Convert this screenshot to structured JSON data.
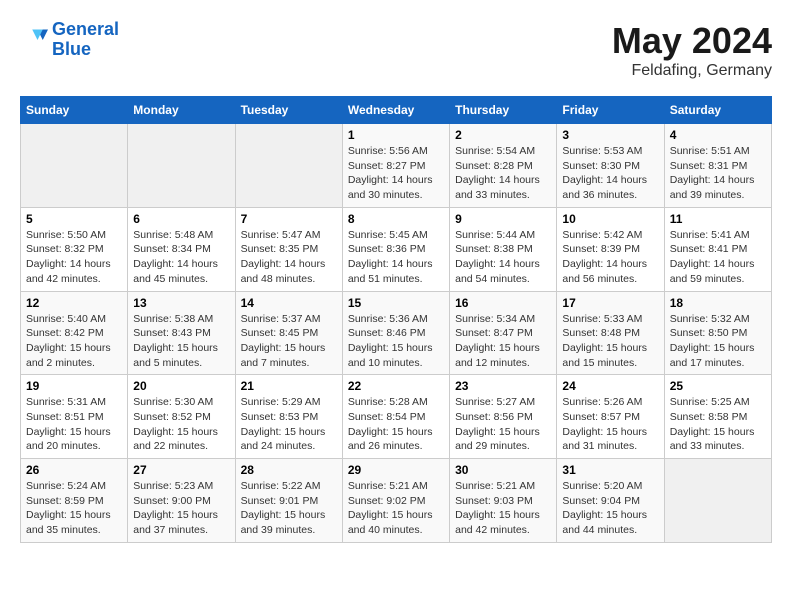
{
  "header": {
    "logo_line1": "General",
    "logo_line2": "Blue",
    "month": "May 2024",
    "location": "Feldafing, Germany"
  },
  "days_of_week": [
    "Sunday",
    "Monday",
    "Tuesday",
    "Wednesday",
    "Thursday",
    "Friday",
    "Saturday"
  ],
  "weeks": [
    [
      {
        "num": "",
        "info": ""
      },
      {
        "num": "",
        "info": ""
      },
      {
        "num": "",
        "info": ""
      },
      {
        "num": "1",
        "info": "Sunrise: 5:56 AM\nSunset: 8:27 PM\nDaylight: 14 hours\nand 30 minutes."
      },
      {
        "num": "2",
        "info": "Sunrise: 5:54 AM\nSunset: 8:28 PM\nDaylight: 14 hours\nand 33 minutes."
      },
      {
        "num": "3",
        "info": "Sunrise: 5:53 AM\nSunset: 8:30 PM\nDaylight: 14 hours\nand 36 minutes."
      },
      {
        "num": "4",
        "info": "Sunrise: 5:51 AM\nSunset: 8:31 PM\nDaylight: 14 hours\nand 39 minutes."
      }
    ],
    [
      {
        "num": "5",
        "info": "Sunrise: 5:50 AM\nSunset: 8:32 PM\nDaylight: 14 hours\nand 42 minutes."
      },
      {
        "num": "6",
        "info": "Sunrise: 5:48 AM\nSunset: 8:34 PM\nDaylight: 14 hours\nand 45 minutes."
      },
      {
        "num": "7",
        "info": "Sunrise: 5:47 AM\nSunset: 8:35 PM\nDaylight: 14 hours\nand 48 minutes."
      },
      {
        "num": "8",
        "info": "Sunrise: 5:45 AM\nSunset: 8:36 PM\nDaylight: 14 hours\nand 51 minutes."
      },
      {
        "num": "9",
        "info": "Sunrise: 5:44 AM\nSunset: 8:38 PM\nDaylight: 14 hours\nand 54 minutes."
      },
      {
        "num": "10",
        "info": "Sunrise: 5:42 AM\nSunset: 8:39 PM\nDaylight: 14 hours\nand 56 minutes."
      },
      {
        "num": "11",
        "info": "Sunrise: 5:41 AM\nSunset: 8:41 PM\nDaylight: 14 hours\nand 59 minutes."
      }
    ],
    [
      {
        "num": "12",
        "info": "Sunrise: 5:40 AM\nSunset: 8:42 PM\nDaylight: 15 hours\nand 2 minutes."
      },
      {
        "num": "13",
        "info": "Sunrise: 5:38 AM\nSunset: 8:43 PM\nDaylight: 15 hours\nand 5 minutes."
      },
      {
        "num": "14",
        "info": "Sunrise: 5:37 AM\nSunset: 8:45 PM\nDaylight: 15 hours\nand 7 minutes."
      },
      {
        "num": "15",
        "info": "Sunrise: 5:36 AM\nSunset: 8:46 PM\nDaylight: 15 hours\nand 10 minutes."
      },
      {
        "num": "16",
        "info": "Sunrise: 5:34 AM\nSunset: 8:47 PM\nDaylight: 15 hours\nand 12 minutes."
      },
      {
        "num": "17",
        "info": "Sunrise: 5:33 AM\nSunset: 8:48 PM\nDaylight: 15 hours\nand 15 minutes."
      },
      {
        "num": "18",
        "info": "Sunrise: 5:32 AM\nSunset: 8:50 PM\nDaylight: 15 hours\nand 17 minutes."
      }
    ],
    [
      {
        "num": "19",
        "info": "Sunrise: 5:31 AM\nSunset: 8:51 PM\nDaylight: 15 hours\nand 20 minutes."
      },
      {
        "num": "20",
        "info": "Sunrise: 5:30 AM\nSunset: 8:52 PM\nDaylight: 15 hours\nand 22 minutes."
      },
      {
        "num": "21",
        "info": "Sunrise: 5:29 AM\nSunset: 8:53 PM\nDaylight: 15 hours\nand 24 minutes."
      },
      {
        "num": "22",
        "info": "Sunrise: 5:28 AM\nSunset: 8:54 PM\nDaylight: 15 hours\nand 26 minutes."
      },
      {
        "num": "23",
        "info": "Sunrise: 5:27 AM\nSunset: 8:56 PM\nDaylight: 15 hours\nand 29 minutes."
      },
      {
        "num": "24",
        "info": "Sunrise: 5:26 AM\nSunset: 8:57 PM\nDaylight: 15 hours\nand 31 minutes."
      },
      {
        "num": "25",
        "info": "Sunrise: 5:25 AM\nSunset: 8:58 PM\nDaylight: 15 hours\nand 33 minutes."
      }
    ],
    [
      {
        "num": "26",
        "info": "Sunrise: 5:24 AM\nSunset: 8:59 PM\nDaylight: 15 hours\nand 35 minutes."
      },
      {
        "num": "27",
        "info": "Sunrise: 5:23 AM\nSunset: 9:00 PM\nDaylight: 15 hours\nand 37 minutes."
      },
      {
        "num": "28",
        "info": "Sunrise: 5:22 AM\nSunset: 9:01 PM\nDaylight: 15 hours\nand 39 minutes."
      },
      {
        "num": "29",
        "info": "Sunrise: 5:21 AM\nSunset: 9:02 PM\nDaylight: 15 hours\nand 40 minutes."
      },
      {
        "num": "30",
        "info": "Sunrise: 5:21 AM\nSunset: 9:03 PM\nDaylight: 15 hours\nand 42 minutes."
      },
      {
        "num": "31",
        "info": "Sunrise: 5:20 AM\nSunset: 9:04 PM\nDaylight: 15 hours\nand 44 minutes."
      },
      {
        "num": "",
        "info": ""
      }
    ]
  ]
}
